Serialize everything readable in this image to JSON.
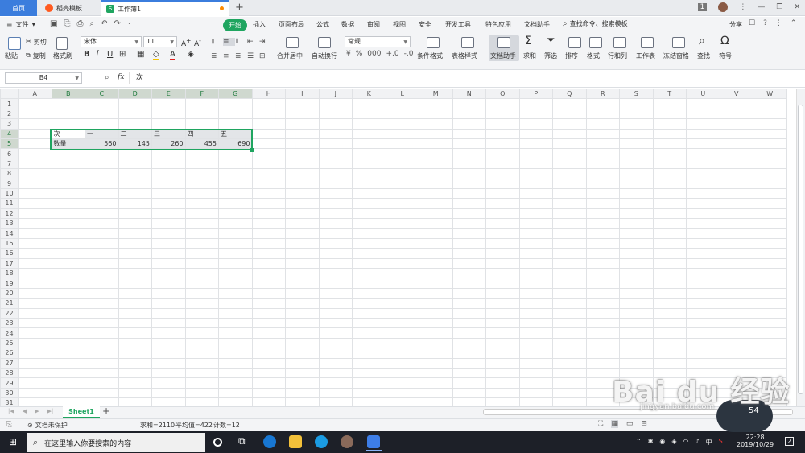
{
  "tabs": {
    "home": "首页",
    "docer": "稻壳模板",
    "workbook": "工作簿1",
    "docer_color": "#ff5a1f",
    "workbook_color": "#1fa560"
  },
  "titlebar": {
    "counter": "1",
    "new_tab": "+"
  },
  "menu": {
    "file": "文件",
    "items": [
      "开始",
      "插入",
      "页面布局",
      "公式",
      "数据",
      "审阅",
      "视图",
      "安全",
      "开发工具",
      "特色应用",
      "文档助手"
    ],
    "search_placeholder": "查找命令、搜索模板",
    "share": "分享",
    "active_color": "#1fa560"
  },
  "ribbon": {
    "paste": "粘贴",
    "cut": "剪切",
    "copy": "复制",
    "format_painter": "格式刷",
    "font_name": "宋体",
    "font_size": "11",
    "bold": "B",
    "italic": "I",
    "underline": "U",
    "merge_center": "合并居中",
    "wrap_text": "自动换行",
    "number_format": "常规",
    "conditional_format": "条件格式",
    "table_style": "表格样式",
    "doc_helper": "文档助手",
    "sum": "求和",
    "filter": "筛选",
    "sort": "排序",
    "format": "格式",
    "row_col": "行和列",
    "worksheet": "工作表",
    "freeze": "冻结窗格",
    "find": "查找",
    "symbol": "符号"
  },
  "formula_bar": {
    "cell_ref": "B4",
    "fx": "fx",
    "content": "次"
  },
  "columns": [
    "A",
    "B",
    "C",
    "D",
    "E",
    "F",
    "G",
    "H",
    "I",
    "J",
    "K",
    "L",
    "M",
    "N",
    "O",
    "P",
    "Q",
    "R",
    "S",
    "T",
    "U",
    "V",
    "W"
  ],
  "rows": [
    "1",
    "2",
    "3",
    "4",
    "5",
    "6",
    "7",
    "8",
    "9",
    "10",
    "11",
    "12",
    "13",
    "14",
    "15",
    "16",
    "17",
    "18",
    "19",
    "20",
    "21",
    "22",
    "23",
    "24",
    "25",
    "26",
    "27",
    "28",
    "29",
    "30",
    "31"
  ],
  "sheet_data": {
    "row4": [
      "次",
      "一",
      "二",
      "三",
      "四",
      "五"
    ],
    "row5": [
      "数量",
      "560",
      "145",
      "260",
      "455",
      "690"
    ]
  },
  "sheet_tabs": {
    "active": "Sheet1",
    "add": "+"
  },
  "status": {
    "protect": "文档未保护",
    "sum": "求和=2110",
    "average": "平均值=422",
    "count": "计数=12"
  },
  "taskbar": {
    "search_placeholder": "在这里输入你要搜索的内容",
    "time": "22:28",
    "date": "2019/10/29",
    "ime": "中",
    "notif_count": "2"
  },
  "watermark": {
    "text": "Bai du 经验",
    "url": "jingyan.baidu.com",
    "badge": "54"
  }
}
